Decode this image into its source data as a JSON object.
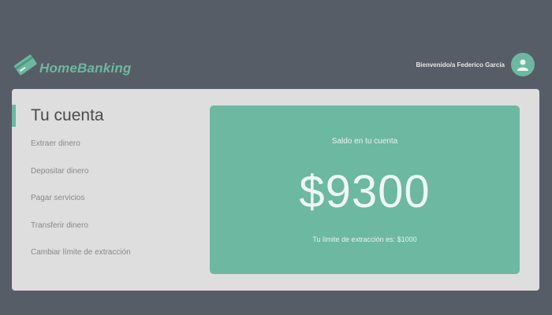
{
  "brand": {
    "name": "HomeBanking",
    "icon": "card-icon",
    "accent": "#6cb8a0"
  },
  "user": {
    "welcome": "Bienvenido/a Federico García",
    "avatar_icon": "user-avatar-icon"
  },
  "sidebar": {
    "title": "Tu cuenta",
    "items": [
      {
        "label": "Extraer dinero"
      },
      {
        "label": "Depositar dinero"
      },
      {
        "label": "Pagar servicios"
      },
      {
        "label": "Transferir dinero"
      },
      {
        "label": "Cambiar límite de extracción"
      }
    ]
  },
  "balance": {
    "label": "Saldo en tu cuenta",
    "amount": "$9300",
    "limit_text": "Tu límite de extracción es: $1000"
  },
  "colors": {
    "background": "#575d66",
    "panel": "#dedede",
    "card": "#6cb8a0"
  }
}
